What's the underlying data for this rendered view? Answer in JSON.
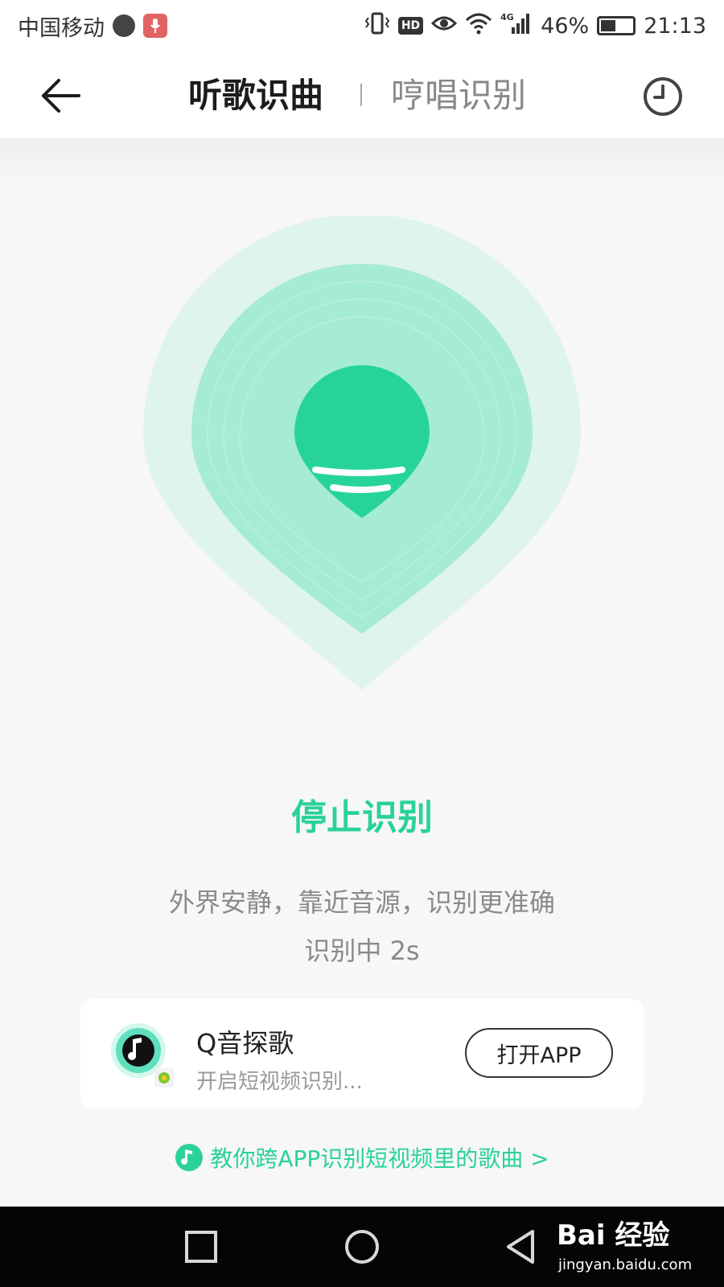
{
  "status_bar": {
    "carrier": "中国移动",
    "hd_badge": "HD",
    "network": "4G",
    "battery_percent": "46%",
    "battery_level": 0.46,
    "time": "21:13"
  },
  "header": {
    "back_icon": "arrow-left-icon",
    "tabs": [
      {
        "label": "听歌识曲",
        "active": true
      },
      {
        "label": "哼唱识别",
        "active": false
      }
    ],
    "history_icon": "clock-icon"
  },
  "recognizer": {
    "stop_label": "停止识别",
    "hint": "外界安静，靠近音源，识别更准确",
    "status": "识别中 2s"
  },
  "promo": {
    "app_name": "Q音探歌",
    "description": "开启短视频识别...",
    "button_label": "打开APP"
  },
  "tutorial_link": "教你跨APP识别短视频里的歌曲 >",
  "watermark": {
    "logo": "Bai 经验",
    "url": "jingyan.baidu.com"
  },
  "colors": {
    "accent": "#2ad29a",
    "pin_outer": "#dff4eb",
    "pin_middle": "#a6ebd4",
    "pin_core": "#26d49a"
  }
}
